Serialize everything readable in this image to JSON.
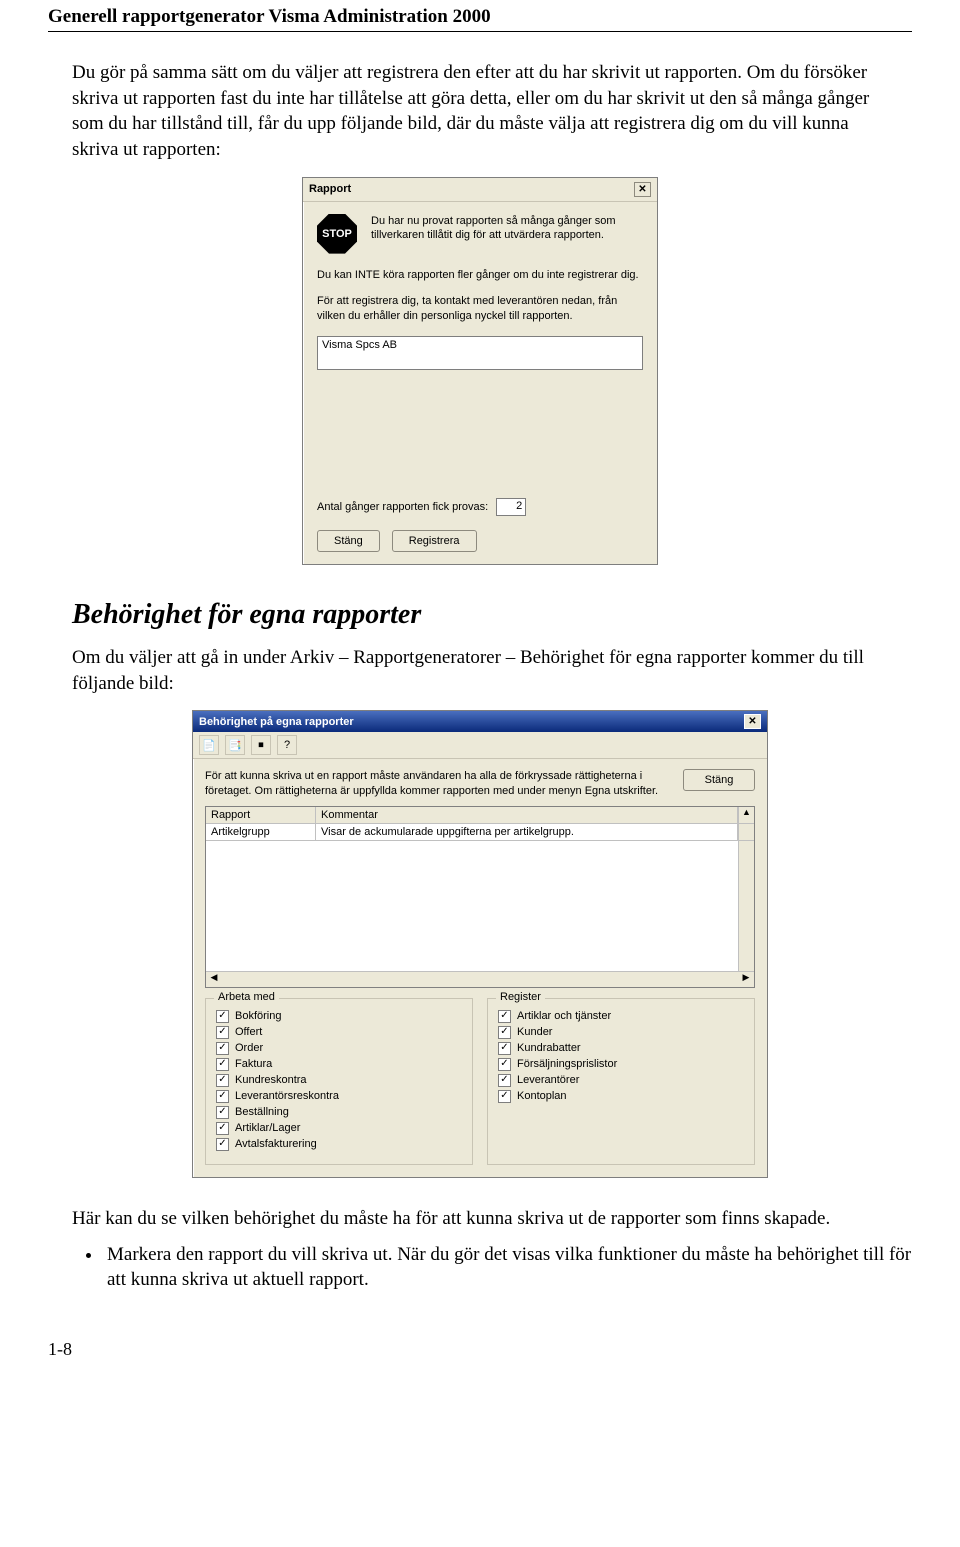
{
  "header": {
    "title": "Generell rapportgenerator Visma Administration 2000"
  },
  "intro": {
    "p1": "Du gör på samma sätt om du väljer att registrera den efter att du har skrivit ut rapporten. Om du försöker skriva ut rapporten fast du inte har tillåtelse att göra detta, eller om du har skrivit ut den så många gånger som du har tillstånd till, får du upp följande bild, där du måste välja att registrera dig om du vill kunna skriva ut rapporten:"
  },
  "dialog1": {
    "title": "Rapport",
    "stop": "STOP",
    "stop_text": "Du har nu provat rapporten så många gånger som tillverkaren tillåtit dig för att utvärdera rapporten.",
    "p2": "Du kan INTE köra rapporten fler gånger om du inte registrerar dig.",
    "p3": "För att registrera dig, ta kontakt med leverantören nedan, från vilken du erhåller din personliga nyckel till rapporten.",
    "vendor": "Visma Spcs AB",
    "count_label": "Antal gånger rapporten fick provas:",
    "count_value": "2",
    "btn_close": "Stäng",
    "btn_register": "Registrera"
  },
  "section2": {
    "heading": "Behörighet för egna rapporter",
    "intro": "Om du väljer att gå in under Arkiv – Rapportgeneratorer – Behörighet för egna rapporter kommer du till följande bild:"
  },
  "dialog2": {
    "title": "Behörighet på egna rapporter",
    "toolbar": {
      "icon1": "📄",
      "icon2": "📑",
      "icon3": "⏹",
      "icon4": "?"
    },
    "info": "För att kunna skriva ut en rapport måste användaren ha alla de förkryssade rättigheterna i företaget. Om rättigheterna är uppfyllda kommer rapporten med under menyn Egna utskrifter.",
    "btn_close": "Stäng",
    "grid": {
      "col1": "Rapport",
      "col2": "Kommentar",
      "row1_c1": "Artikelgrupp",
      "row1_c2": "Visar de ackumularade uppgifterna per artikelgrupp."
    },
    "group_arbeta": {
      "title": "Arbeta med",
      "items": [
        "Bokföring",
        "Offert",
        "Order",
        "Faktura",
        "Kundreskontra",
        "Leverantörsreskontra",
        "Beställning",
        "Artiklar/Lager",
        "Avtalsfakturering"
      ]
    },
    "group_register": {
      "title": "Register",
      "items": [
        "Artiklar och tjänster",
        "Kunder",
        "Kundrabatter",
        "Försäljningsprislistor",
        "Leverantörer",
        "Kontoplan"
      ]
    }
  },
  "outro": {
    "p1": "Här kan du se vilken behörighet du måste ha för att kunna skriva ut de rapporter som finns skapade.",
    "b1": "Markera den rapport du vill skriva ut. När du gör det visas vilka funktioner du måste ha behörighet till för att kunna skriva ut aktuell rapport."
  },
  "pagenum": "1-8"
}
